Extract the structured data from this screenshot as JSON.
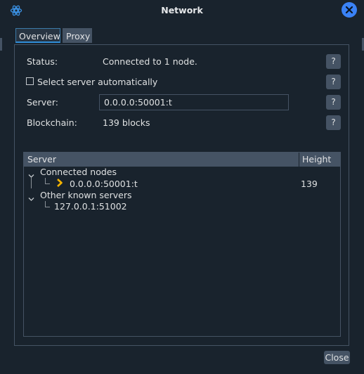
{
  "window": {
    "title": "Network"
  },
  "tabs": [
    {
      "label": "Overview",
      "active": true
    },
    {
      "label": "Proxy",
      "active": false
    }
  ],
  "overview": {
    "status_label": "Status:",
    "status_value": "Connected to 1 node.",
    "auto_select_label": "Select server automatically",
    "auto_select_checked": false,
    "server_label": "Server:",
    "server_value": "0.0.0.0:50001:t",
    "blockchain_label": "Blockchain:",
    "blockchain_value": "139 blocks",
    "help_label": "?"
  },
  "tree": {
    "columns": [
      "Server",
      "Height"
    ],
    "groups": [
      {
        "label": "Connected nodes",
        "items": [
          {
            "server": "0.0.0.0:50001:t",
            "height": "139",
            "current": true
          }
        ]
      },
      {
        "label": "Other known servers",
        "items": [
          {
            "server": "127.0.0.1:51002",
            "height": ""
          }
        ]
      }
    ]
  },
  "footer": {
    "close_label": "Close"
  },
  "colors": {
    "background": "#19232d",
    "accent": "#2f8ed8",
    "close_icon": "#3a82f6",
    "current_marker": "#f5b400"
  },
  "icons": {
    "app": "electrum-icon",
    "window_close": "close-icon",
    "expand": "chevron-down-icon",
    "current": "chevron-right-icon"
  }
}
